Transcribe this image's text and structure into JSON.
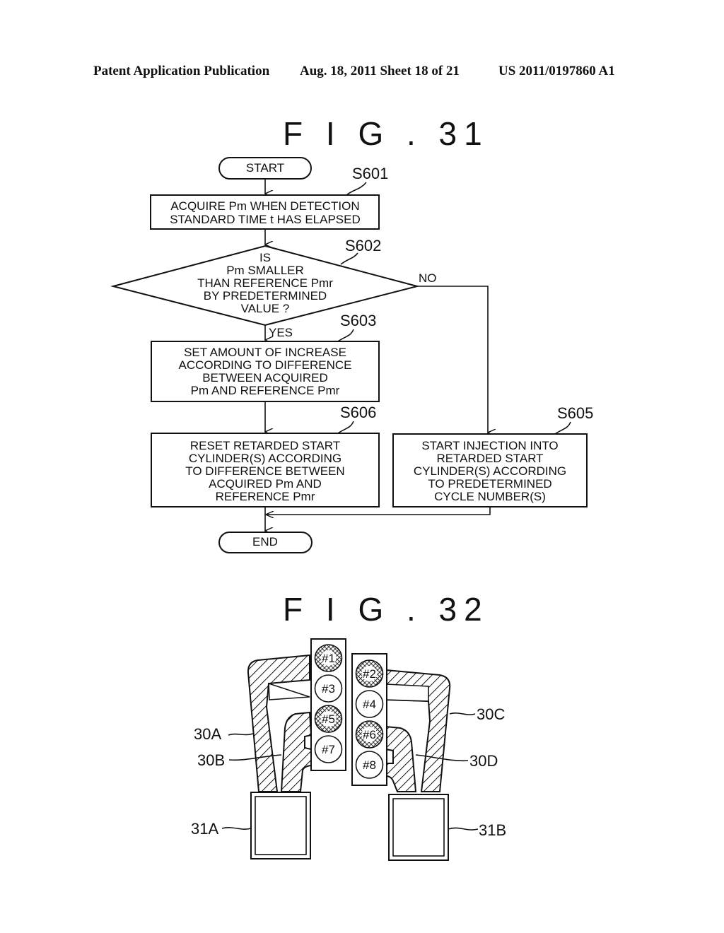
{
  "header": {
    "publication": "Patent Application Publication",
    "date_sheet": "Aug. 18, 2011  Sheet 18 of 21",
    "number": "US 2011/0197860 A1"
  },
  "fig31": {
    "title": "F I G . 31",
    "start": "START",
    "end": "END",
    "steps": {
      "s601": {
        "ref": "S601",
        "lines": [
          "ACQUIRE Pm WHEN DETECTION",
          "STANDARD TIME t HAS ELAPSED"
        ]
      },
      "s602": {
        "ref": "S602",
        "lines": [
          "IS",
          "Pm SMALLER",
          "THAN REFERENCE Pmr",
          "BY PREDETERMINED",
          "VALUE ?"
        ],
        "yes": "YES",
        "no": "NO"
      },
      "s603": {
        "ref": "S603",
        "lines": [
          "SET AMOUNT OF INCREASE",
          "ACCORDING TO DIFFERENCE",
          "BETWEEN ACQUIRED",
          "Pm AND REFERENCE Pmr"
        ]
      },
      "s606": {
        "ref": "S606",
        "lines": [
          "RESET RETARDED START",
          "CYLINDER(S) ACCORDING",
          "TO DIFFERENCE BETWEEN",
          "ACQUIRED Pm AND",
          "REFERENCE Pmr"
        ]
      },
      "s605": {
        "ref": "S605",
        "lines": [
          "START INJECTION INTO",
          "RETARDED START",
          "CYLINDER(S) ACCORDING",
          "TO PREDETERMINED",
          "CYCLE NUMBER(S)"
        ]
      }
    }
  },
  "fig32": {
    "title": "F I G . 32",
    "left_bank": [
      {
        "label": "#1",
        "hatched": true
      },
      {
        "label": "#3",
        "hatched": false
      },
      {
        "label": "#5",
        "hatched": true
      },
      {
        "label": "#7",
        "hatched": false
      }
    ],
    "right_bank": [
      {
        "label": "#2",
        "hatched": true
      },
      {
        "label": "#4",
        "hatched": false
      },
      {
        "label": "#6",
        "hatched": true
      },
      {
        "label": "#8",
        "hatched": false
      }
    ],
    "refs": {
      "r30a": "30A",
      "r30b": "30B",
      "r30c": "30C",
      "r30d": "30D",
      "r31a": "31A",
      "r31b": "31B"
    }
  }
}
